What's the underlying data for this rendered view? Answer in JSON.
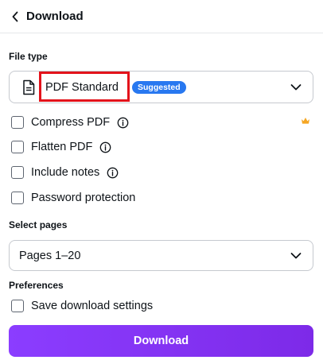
{
  "header": {
    "title": "Download",
    "back_icon": "chevron-left-icon"
  },
  "file_type": {
    "label": "File type",
    "icon": "document-icon",
    "value": "PDF Standard",
    "badge": "Suggested",
    "badge_color": "#2878f0"
  },
  "options": {
    "compress_label": "Compress PDF",
    "compress_checked": false,
    "compress_premium_icon": "crown-icon",
    "flatten_label": "Flatten PDF",
    "flatten_checked": false,
    "notes_label": "Include notes",
    "notes_checked": false,
    "password_label": "Password protection",
    "password_checked": false
  },
  "pages": {
    "label": "Select pages",
    "value": "Pages 1–20"
  },
  "preferences": {
    "label": "Preferences",
    "save_settings_label": "Save download settings",
    "save_settings_checked": false
  },
  "download_button": {
    "label": "Download",
    "color": "#8b3dff"
  },
  "colors": {
    "highlight": "#e3131b",
    "crown": "#f5a623"
  }
}
